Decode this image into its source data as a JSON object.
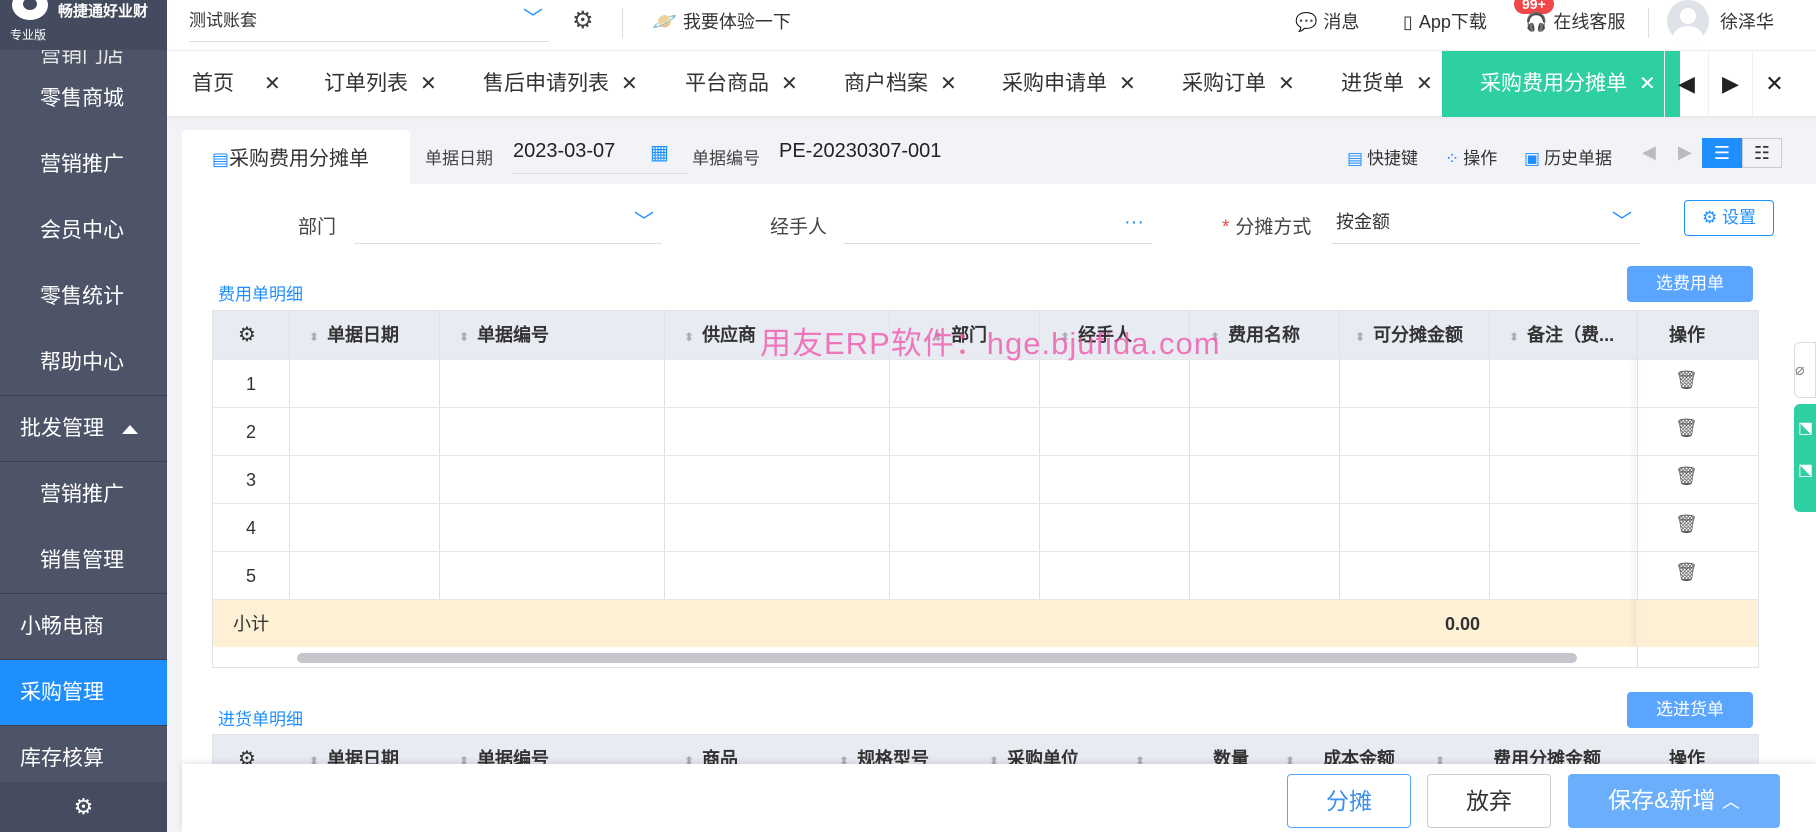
{
  "brand": {
    "name": "畅捷通好业财",
    "edition": "专业版"
  },
  "sidebar": {
    "items": [
      {
        "label": "营销门店",
        "kind": "partial"
      },
      {
        "label": "零售商城",
        "kind": "sub"
      },
      {
        "label": "营销推广",
        "kind": "sub"
      },
      {
        "label": "会员中心",
        "kind": "sub"
      },
      {
        "label": "零售统计",
        "kind": "sub"
      },
      {
        "label": "帮助中心",
        "kind": "sub"
      },
      {
        "label": "批发管理",
        "kind": "top",
        "expanded": true
      },
      {
        "label": "营销推广",
        "kind": "sub"
      },
      {
        "label": "销售管理",
        "kind": "sub"
      },
      {
        "label": "小畅电商",
        "kind": "top"
      },
      {
        "label": "采购管理",
        "kind": "top",
        "active": true
      },
      {
        "label": "库存核算",
        "kind": "top"
      }
    ],
    "settings_icon": "gear-icon"
  },
  "topbar": {
    "account": "测试账套",
    "try_label": "我要体验一下",
    "messages": "消息",
    "messages_badge": "99+",
    "app_download": "App下载",
    "online_service": "在线客服",
    "user": "徐泽华"
  },
  "tabs": [
    {
      "label": "首页"
    },
    {
      "label": "订单列表"
    },
    {
      "label": "售后申请列表"
    },
    {
      "label": "平台商品"
    },
    {
      "label": "商户档案"
    },
    {
      "label": "采购申请单"
    },
    {
      "label": "采购订单"
    },
    {
      "label": "进货单"
    },
    {
      "label": "采购费用分摊单",
      "active": true
    }
  ],
  "doc": {
    "tab_title": "采购费用分摊单",
    "date_label": "单据日期",
    "date_value": "2023-03-07",
    "number_label": "单据编号",
    "number_value": "PE-20230307-001",
    "shortcut": "快捷键",
    "operation": "操作",
    "history": "历史单据"
  },
  "form": {
    "dept_label": "部门",
    "dept_value": "",
    "handler_label": "经手人",
    "handler_value": "",
    "alloc_label": "分摊方式",
    "alloc_value": "按金额",
    "settings_btn": "设置"
  },
  "expense": {
    "section_title": "费用单明细",
    "select_btn": "选费用单",
    "columns": [
      "单据日期",
      "单据编号",
      "供应商",
      "部门",
      "经手人",
      "费用名称",
      "可分摊金额",
      "备注（费...",
      "操作"
    ],
    "rows": [
      "1",
      "2",
      "3",
      "4",
      "5"
    ],
    "subtotal_label": "小计",
    "subtotal_amount": "0.00"
  },
  "watermark": "用友ERP软件：hge.bjufida.com",
  "purchase": {
    "section_title": "进货单明细",
    "select_btn": "选进货单",
    "columns": [
      "单据日期",
      "单据编号",
      "商品",
      "规格型号",
      "采购单位",
      "数量",
      "成本金额",
      "费用分摊金额",
      "操作"
    ]
  },
  "footer": {
    "allocate": "分摊",
    "discard": "放弃",
    "save_new": "保存&新增"
  },
  "colors": {
    "accent": "#1f8fff",
    "tab_active": "#2ecfa2",
    "sidebar": "#4e5468",
    "subtotal_bg": "#fdf0d5"
  }
}
